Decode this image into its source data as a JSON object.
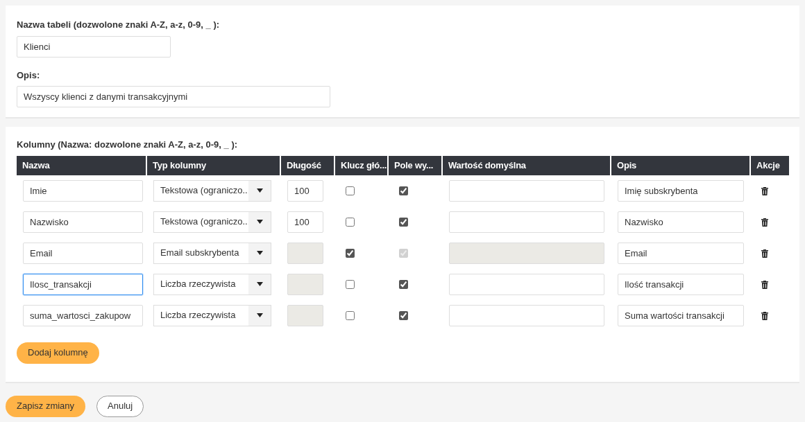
{
  "table_settings": {
    "name_label": "Nazwa tabeli (dozwolone znaki A-Z, a-z, 0-9, _ ):",
    "name_value": "Klienci",
    "description_label": "Opis:",
    "description_value": "Wszyscy klienci z danymi transakcyjnymi"
  },
  "columns_section": {
    "label": "Kolumny (Nazwa: dozwolone znaki A-Z, a-z, 0-9, _ ):",
    "headers": [
      "Nazwa",
      "Typ kolumny",
      "Długość",
      "Klucz głó...",
      "Pole wy...",
      "Wartość domyślna",
      "Opis",
      "Akcje"
    ],
    "rows": [
      {
        "name": "Imie",
        "focused": false,
        "type": "Tekstowa (ograniczo...",
        "length": "100",
        "length_disabled": false,
        "primary_key": false,
        "visible": true,
        "visible_disabled": false,
        "default_disabled": false,
        "description": "Imię subskrybenta"
      },
      {
        "name": "Nazwisko",
        "focused": false,
        "type": "Tekstowa (ograniczo...",
        "length": "100",
        "length_disabled": false,
        "primary_key": false,
        "visible": true,
        "visible_disabled": false,
        "default_disabled": false,
        "description": "Nazwisko"
      },
      {
        "name": "Email",
        "focused": false,
        "type": "Email subskrybenta",
        "length_disabled": true,
        "primary_key": true,
        "visible": true,
        "visible_disabled": true,
        "default_disabled": true,
        "description": "Email"
      },
      {
        "name": "Ilosc_transakcji",
        "focused": true,
        "type": "Liczba rzeczywista",
        "length_disabled": true,
        "primary_key": false,
        "visible": true,
        "visible_disabled": false,
        "default_disabled": false,
        "description": "Ilość transakcji"
      },
      {
        "name": "suma_wartosci_zakupow",
        "focused": false,
        "type": "Liczba rzeczywista",
        "length_disabled": true,
        "primary_key": false,
        "visible": true,
        "visible_disabled": false,
        "default_disabled": false,
        "description": "Suma wartości transakcji"
      }
    ],
    "add_button": "Dodaj kolumnę"
  },
  "footer": {
    "save_button": "Zapisz zmiany",
    "cancel_button": "Anuluj"
  }
}
